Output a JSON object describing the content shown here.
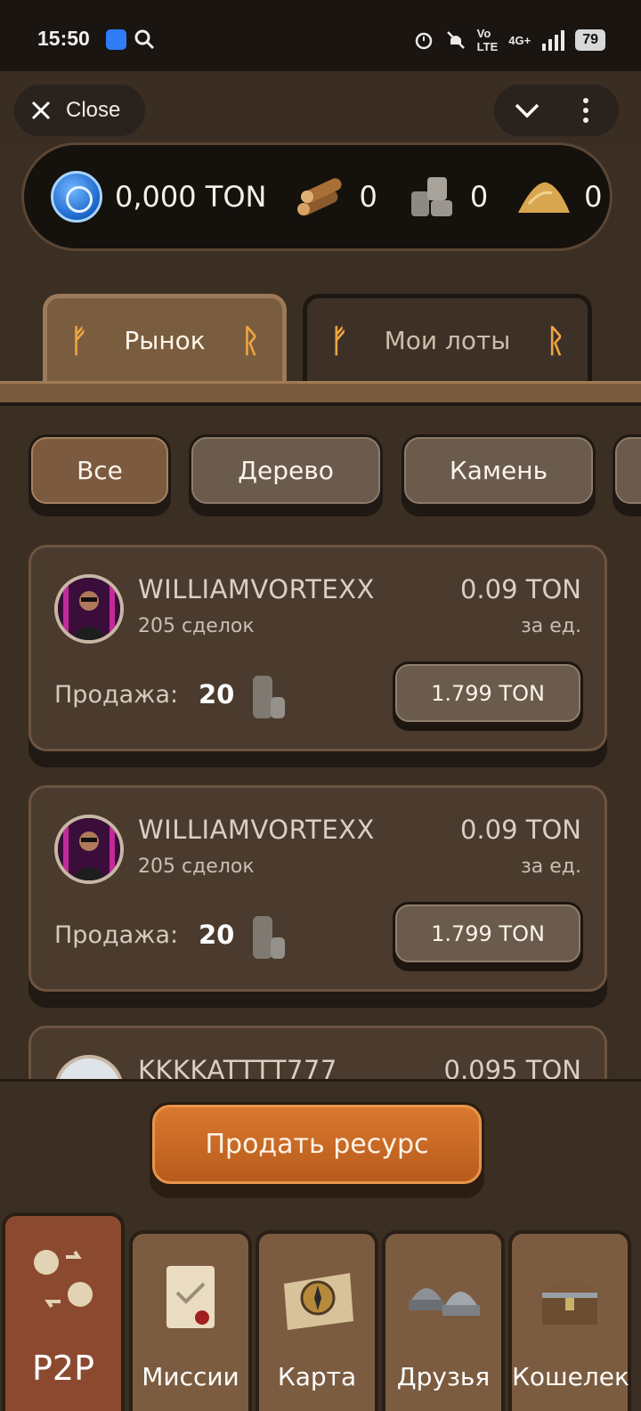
{
  "status_bar": {
    "time": "15:50",
    "battery": "79",
    "network": "4G+"
  },
  "header": {
    "close_label": "Close"
  },
  "balance": {
    "ton": "0,000 TON",
    "wood": "0",
    "stone": "0",
    "sand": "0"
  },
  "tabs": [
    {
      "label": "Рынок",
      "active": true
    },
    {
      "label": "Мои лоты",
      "active": false
    }
  ],
  "filters": [
    {
      "label": "Все",
      "active": true
    },
    {
      "label": "Дерево",
      "active": false
    },
    {
      "label": "Камень",
      "active": false
    }
  ],
  "listings": [
    {
      "seller": "WILLIAMVORTEXX",
      "deals": "205 сделок",
      "price": "0.09 TON",
      "per_unit": "за ед.",
      "sale_label": "Продажа:",
      "quantity": "20",
      "total": "1.799 TON"
    },
    {
      "seller": "WILLIAMVORTEXX",
      "deals": "205 сделок",
      "price": "0.09 TON",
      "per_unit": "за ед.",
      "sale_label": "Продажа:",
      "quantity": "20",
      "total": "1.799 TON"
    },
    {
      "seller": "KKKKATTTT777",
      "deals": "",
      "price": "0.095 TON",
      "per_unit": "",
      "sale_label": "",
      "quantity": "",
      "total": ""
    }
  ],
  "sell_button": "Продать ресурс",
  "nav": [
    {
      "label": "P2P",
      "icon": "exchange-hands-icon",
      "active": true
    },
    {
      "label": "Миссии",
      "icon": "scroll-icon",
      "active": false
    },
    {
      "label": "Карта",
      "icon": "compass-map-icon",
      "active": false
    },
    {
      "label": "Друзья",
      "icon": "viking-helmets-icon",
      "active": false
    },
    {
      "label": "Кошелек",
      "icon": "treasure-chest-icon",
      "active": false
    }
  ]
}
